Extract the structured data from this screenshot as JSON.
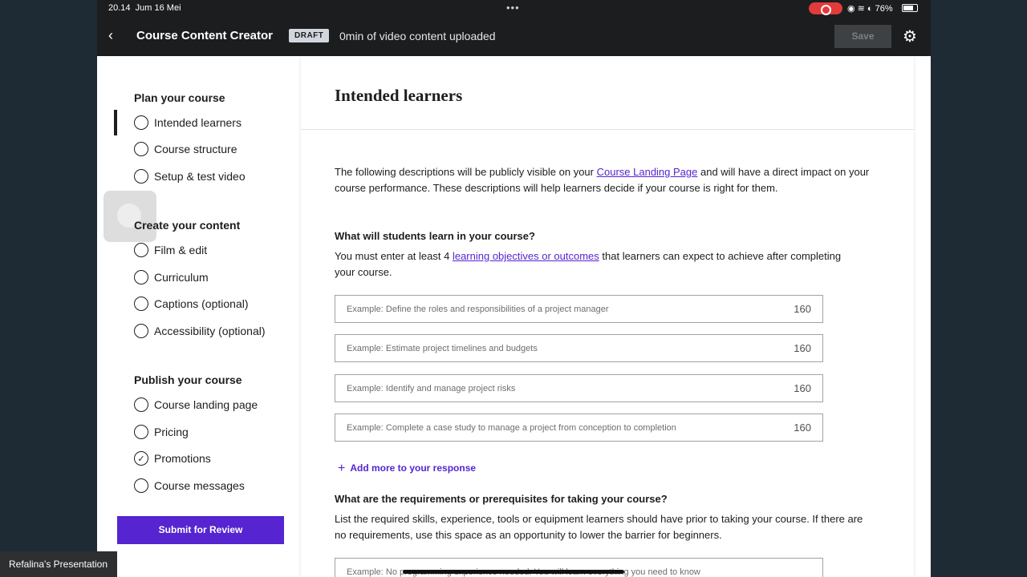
{
  "status": {
    "time": "20.14",
    "date": "Jum 16 Mei",
    "battery": "76%"
  },
  "topbar": {
    "title": "Course Content Creator",
    "badge": "DRAFT",
    "uploaded": "0min of video content uploaded",
    "save_label": "Save"
  },
  "sidebar": {
    "plan_title": "Plan your course",
    "plan_items": [
      "Intended learners",
      "Course structure",
      "Setup & test video"
    ],
    "create_title": "Create your content",
    "create_items": [
      "Film & edit",
      "Curriculum",
      "Captions (optional)",
      "Accessibility (optional)"
    ],
    "publish_title": "Publish your course",
    "publish_items": [
      "Course landing page",
      "Pricing",
      "Promotions",
      "Course messages"
    ],
    "submit_label": "Submit for Review"
  },
  "main": {
    "title": "Intended learners",
    "intro_a": "The following descriptions will be publicly visible on your ",
    "intro_link": "Course Landing Page",
    "intro_b": " and will have a direct impact on your course performance. These descriptions will help learners decide if your course is right for them.",
    "q1": "What will students learn in your course?",
    "q1_desc_a": "You must enter at least 4 ",
    "q1_link": "learning objectives or outcomes",
    "q1_desc_b": " that learners can expect to achieve after completing your course.",
    "objectives": [
      {
        "placeholder": "Example: Define the roles and responsibilities of a project manager",
        "count": "160"
      },
      {
        "placeholder": "Example: Estimate project timelines and budgets",
        "count": "160"
      },
      {
        "placeholder": "Example: Identify and manage project risks",
        "count": "160"
      },
      {
        "placeholder": "Example: Complete a case study to manage a project from conception to completion",
        "count": "160"
      }
    ],
    "add_more": "Add more to your response",
    "q2": "What are the requirements or prerequisites for taking your course?",
    "q2_desc": "List the required skills, experience, tools or equipment learners should have prior to taking your course. If there are no requirements, use this space as an opportunity to lower the barrier for beginners.",
    "req_placeholder": "Example: No programming experience needed. You will learn everything you need to know"
  },
  "presenter_label": "Refalina's Presentation"
}
